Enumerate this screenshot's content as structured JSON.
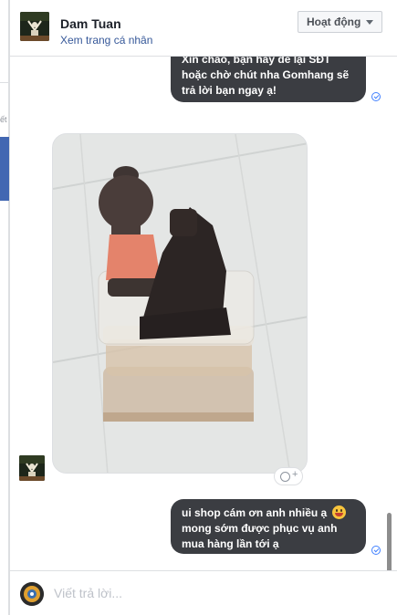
{
  "header": {
    "name": "Dam Tuan",
    "profile_link": "Xem trang cá nhân",
    "status_button": "Hoạt động"
  },
  "messages": [
    {
      "id": "m1",
      "sender": "page",
      "text": "Xin chào, bạn hãy để lại SĐT hoặc chờ chút nha Gomhang sẽ trả lời bạn ngay ạ!",
      "seen": true
    },
    {
      "id": "m2",
      "sender": "user",
      "type": "photo",
      "photo_subject": "ceramic-buddha-incense-burner-on-plastic-boxes"
    },
    {
      "id": "m3",
      "sender": "page",
      "text": "ui shop cám ơn anh nhiều ạ",
      "text_after_emoji": "mong sớm được phục vụ anh mua hàng lần tới ạ",
      "emoji": "smiling-face-with-tongue",
      "seen": true
    }
  ],
  "composer": {
    "placeholder": "Viết trả lời..."
  },
  "left_fragment": "ết",
  "colors": {
    "bubble": "#3b3d42",
    "link": "#365899",
    "seen": "#4080ff",
    "fb_blue": "#4267b2"
  }
}
